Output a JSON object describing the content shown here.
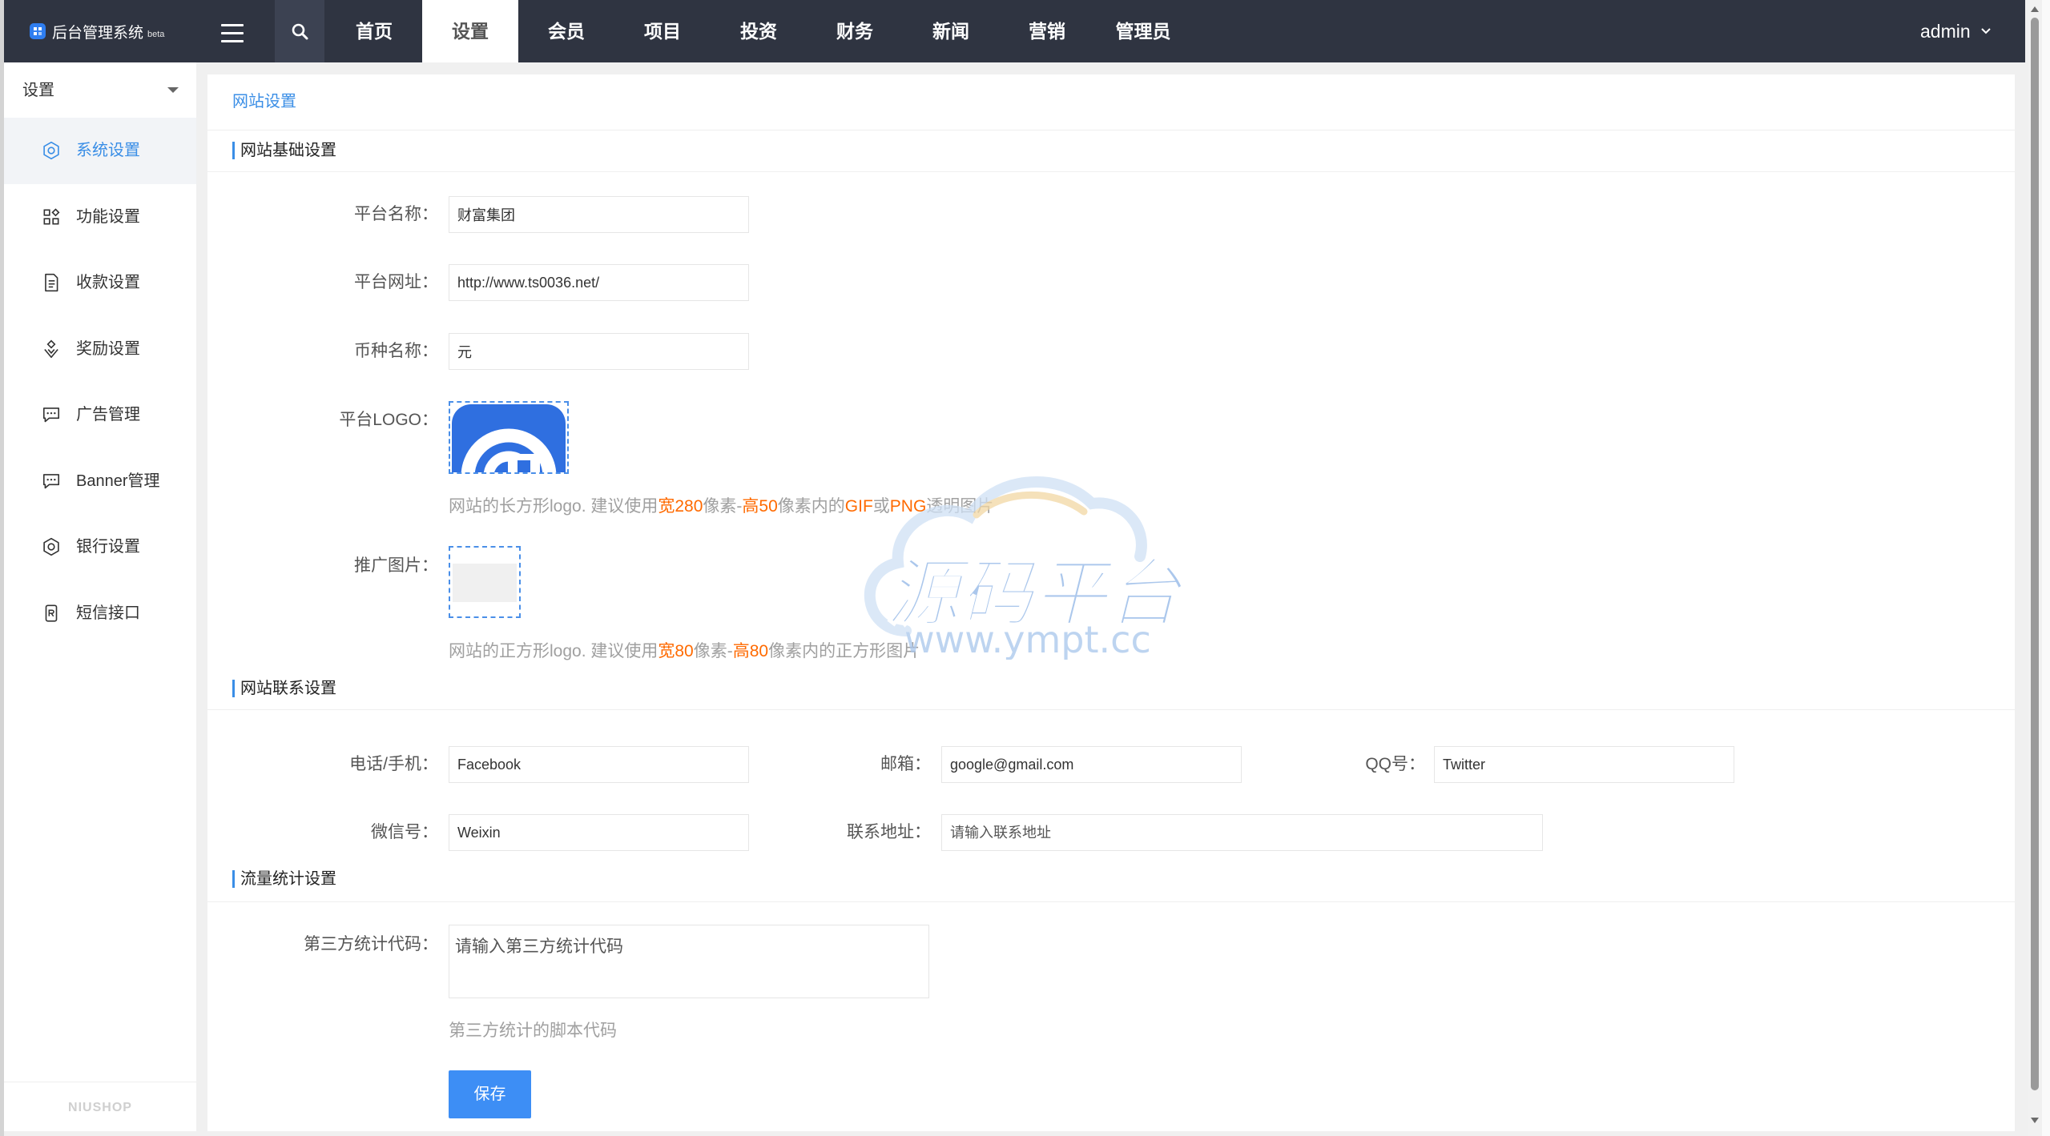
{
  "app": {
    "title": "后台管理系统",
    "badge": "beta"
  },
  "topbar": {
    "nav": [
      "首页",
      "设置",
      "会员",
      "项目",
      "投资",
      "财务",
      "新闻",
      "营销",
      "管理员"
    ],
    "active_index": 1,
    "user": "admin"
  },
  "sidebar": {
    "title": "设置",
    "active_index": 0,
    "items": [
      {
        "label": "系统设置",
        "icon": "gear-icon"
      },
      {
        "label": "功能设置",
        "icon": "module-icon"
      },
      {
        "label": "收款设置",
        "icon": "document-icon"
      },
      {
        "label": "奖励设置",
        "icon": "award-icon"
      },
      {
        "label": "广告管理",
        "icon": "message-icon"
      },
      {
        "label": "Banner管理",
        "icon": "message-icon"
      },
      {
        "label": "银行设置",
        "icon": "gear-icon"
      },
      {
        "label": "短信接口",
        "icon": "sms-icon"
      }
    ],
    "footer": "NIUSHOP"
  },
  "breadcrumb": "网站设置",
  "basic": {
    "title": "网站基础设置",
    "platform_name": {
      "label": "平台名称：",
      "value": "财富集团"
    },
    "platform_url": {
      "label": "平台网址：",
      "value": "http://www.ts0036.net/"
    },
    "currency_name": {
      "label": "币种名称：",
      "value": "元"
    },
    "logo": {
      "label": "平台LOGO：",
      "help": [
        "网站的长方形logo. 建议使用",
        "宽280",
        "像素-",
        "高50",
        "像素内的",
        "GIF",
        "或",
        "PNG",
        "透明图片"
      ]
    },
    "promo_image": {
      "label": "推广图片：",
      "help": [
        "网站的正方形logo. 建议使用",
        "宽80",
        "像素-",
        "高80",
        "像素内的正方形图片"
      ]
    }
  },
  "contact": {
    "title": "网站联系设置",
    "phone": {
      "label": "电话/手机：",
      "value": "Facebook"
    },
    "email": {
      "label": "邮箱：",
      "value": "google@gmail.com"
    },
    "qq": {
      "label": "QQ号：",
      "value": "Twitter"
    },
    "wechat": {
      "label": "微信号：",
      "value": "Weixin"
    },
    "address": {
      "label": "联系地址：",
      "placeholder": "请输入联系地址"
    }
  },
  "stats": {
    "title": "流量统计设置",
    "code": {
      "label": "第三方统计代码：",
      "placeholder": "请输入第三方统计代码",
      "help": "第三方统计的脚本代码"
    }
  },
  "save_label": "保存",
  "colors": {
    "topbar": "#2f3441",
    "accent": "#3a8ee6",
    "highlight": "#ff6a00",
    "button": "#3d8ef5"
  },
  "watermark": {
    "title": "源码平台",
    "url": "www.ympt.cc"
  }
}
